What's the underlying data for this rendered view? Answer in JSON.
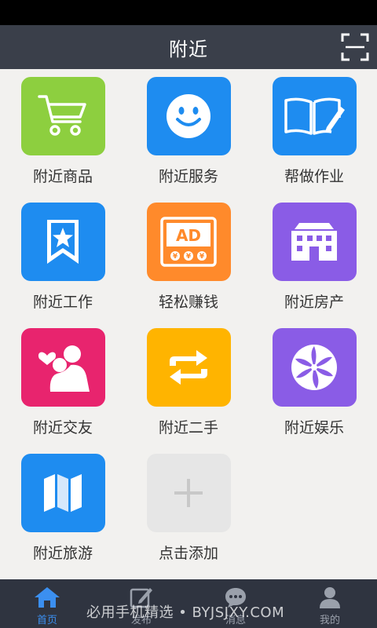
{
  "header": {
    "title": "附近"
  },
  "grid": {
    "items": [
      {
        "label": "附近商品",
        "icon": "shopping-cart-icon",
        "color": "#8dcf3f"
      },
      {
        "label": "附近服务",
        "icon": "smiley-face-icon",
        "color": "#1e8cf0"
      },
      {
        "label": "帮做作业",
        "icon": "book-pen-icon",
        "color": "#1e8cf0"
      },
      {
        "label": "附近工作",
        "icon": "bookmark-star-icon",
        "color": "#1e8cf0"
      },
      {
        "label": "轻松赚钱",
        "icon": "ad-money-icon",
        "color": "#ff8a2b",
        "badge": "AD"
      },
      {
        "label": "附近房产",
        "icon": "building-icon",
        "color": "#8a5ce6"
      },
      {
        "label": "附近交友",
        "icon": "couple-heart-icon",
        "color": "#e8246e"
      },
      {
        "label": "附近二手",
        "icon": "exchange-arrows-icon",
        "color": "#ffb400"
      },
      {
        "label": "附近娱乐",
        "icon": "candy-swirl-icon",
        "color": "#8a5ce6"
      },
      {
        "label": "附近旅游",
        "icon": "map-icon",
        "color": "#1e8cf0"
      },
      {
        "label": "点击添加",
        "icon": "plus-icon",
        "color": "#e6e6e6"
      }
    ]
  },
  "bottom_nav": {
    "items": [
      {
        "label": "首页",
        "icon": "home-icon",
        "active": true
      },
      {
        "label": "发布",
        "icon": "edit-icon",
        "active": false
      },
      {
        "label": "消息",
        "icon": "chat-bubble-icon",
        "active": false
      },
      {
        "label": "我的",
        "icon": "person-icon",
        "active": false
      }
    ]
  },
  "watermark": "必用手机精选 • BYJSJXY.COM"
}
